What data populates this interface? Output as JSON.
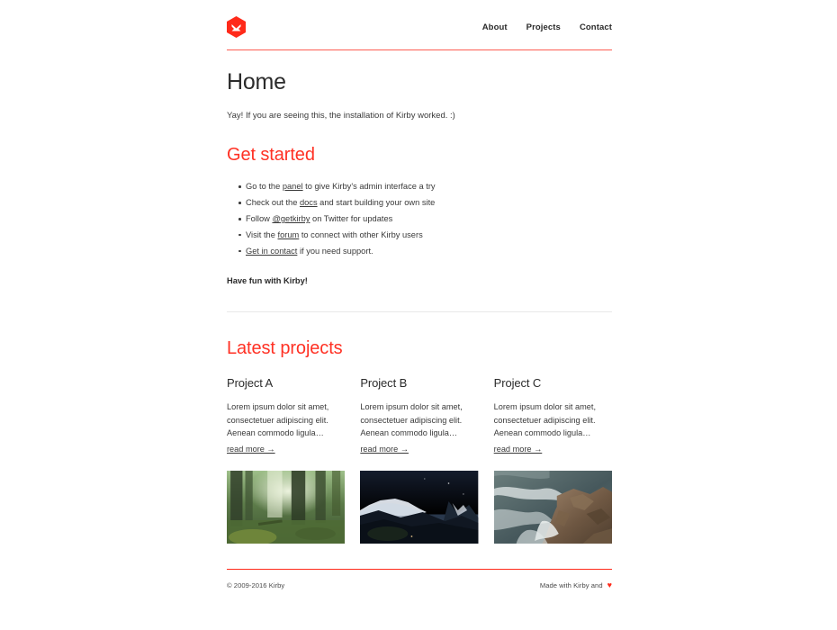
{
  "header": {
    "logo_icon": "kirby-hexagon-logo",
    "logo_color": "#ff2a1a",
    "nav": [
      {
        "label": "About"
      },
      {
        "label": "Projects"
      },
      {
        "label": "Contact"
      }
    ]
  },
  "main": {
    "title": "Home",
    "intro": "Yay! If you are seeing this, the installation of Kirby worked. :)",
    "get_started": {
      "heading": "Get started",
      "items": [
        {
          "before": "Go to the ",
          "link": "panel",
          "after": " to give Kirby's admin interface a try"
        },
        {
          "before": "Check out the ",
          "link": "docs",
          "after": " and start building your own site"
        },
        {
          "before": "Follow ",
          "link": "@getkirby",
          "after": " on Twitter for updates"
        },
        {
          "before": "Visit the ",
          "link": "forum",
          "after": " to connect with other Kirby users"
        },
        {
          "before": "",
          "link": "Get in contact",
          "after": " if you need support."
        }
      ],
      "closing": "Have fun with Kirby!"
    },
    "projects": {
      "heading": "Latest projects",
      "items": [
        {
          "title": "Project A",
          "excerpt": "Lorem ipsum dolor sit amet, consectetuer adipiscing elit. Aenean commodo ligula…",
          "read_more": "read more →",
          "image_alt": "forest-clearing-photo"
        },
        {
          "title": "Project B",
          "excerpt": "Lorem ipsum dolor sit amet, consectetuer adipiscing elit. Aenean commodo ligula…",
          "read_more": "read more →",
          "image_alt": "night-mountain-photo"
        },
        {
          "title": "Project C",
          "excerpt": "Lorem ipsum dolor sit amet, consectetuer adipiscing elit. Aenean commodo ligula…",
          "read_more": "read more →",
          "image_alt": "waves-on-rocks-photo"
        }
      ]
    }
  },
  "footer": {
    "copyright": "© 2009-2016 Kirby",
    "made_with": "Made with Kirby and",
    "heart_icon": "♥"
  },
  "colors": {
    "accent_red": "#ff3124",
    "rule_red": "#fd5d52",
    "rule_gray": "#e8e8e8",
    "text": "#3a3a3a"
  }
}
